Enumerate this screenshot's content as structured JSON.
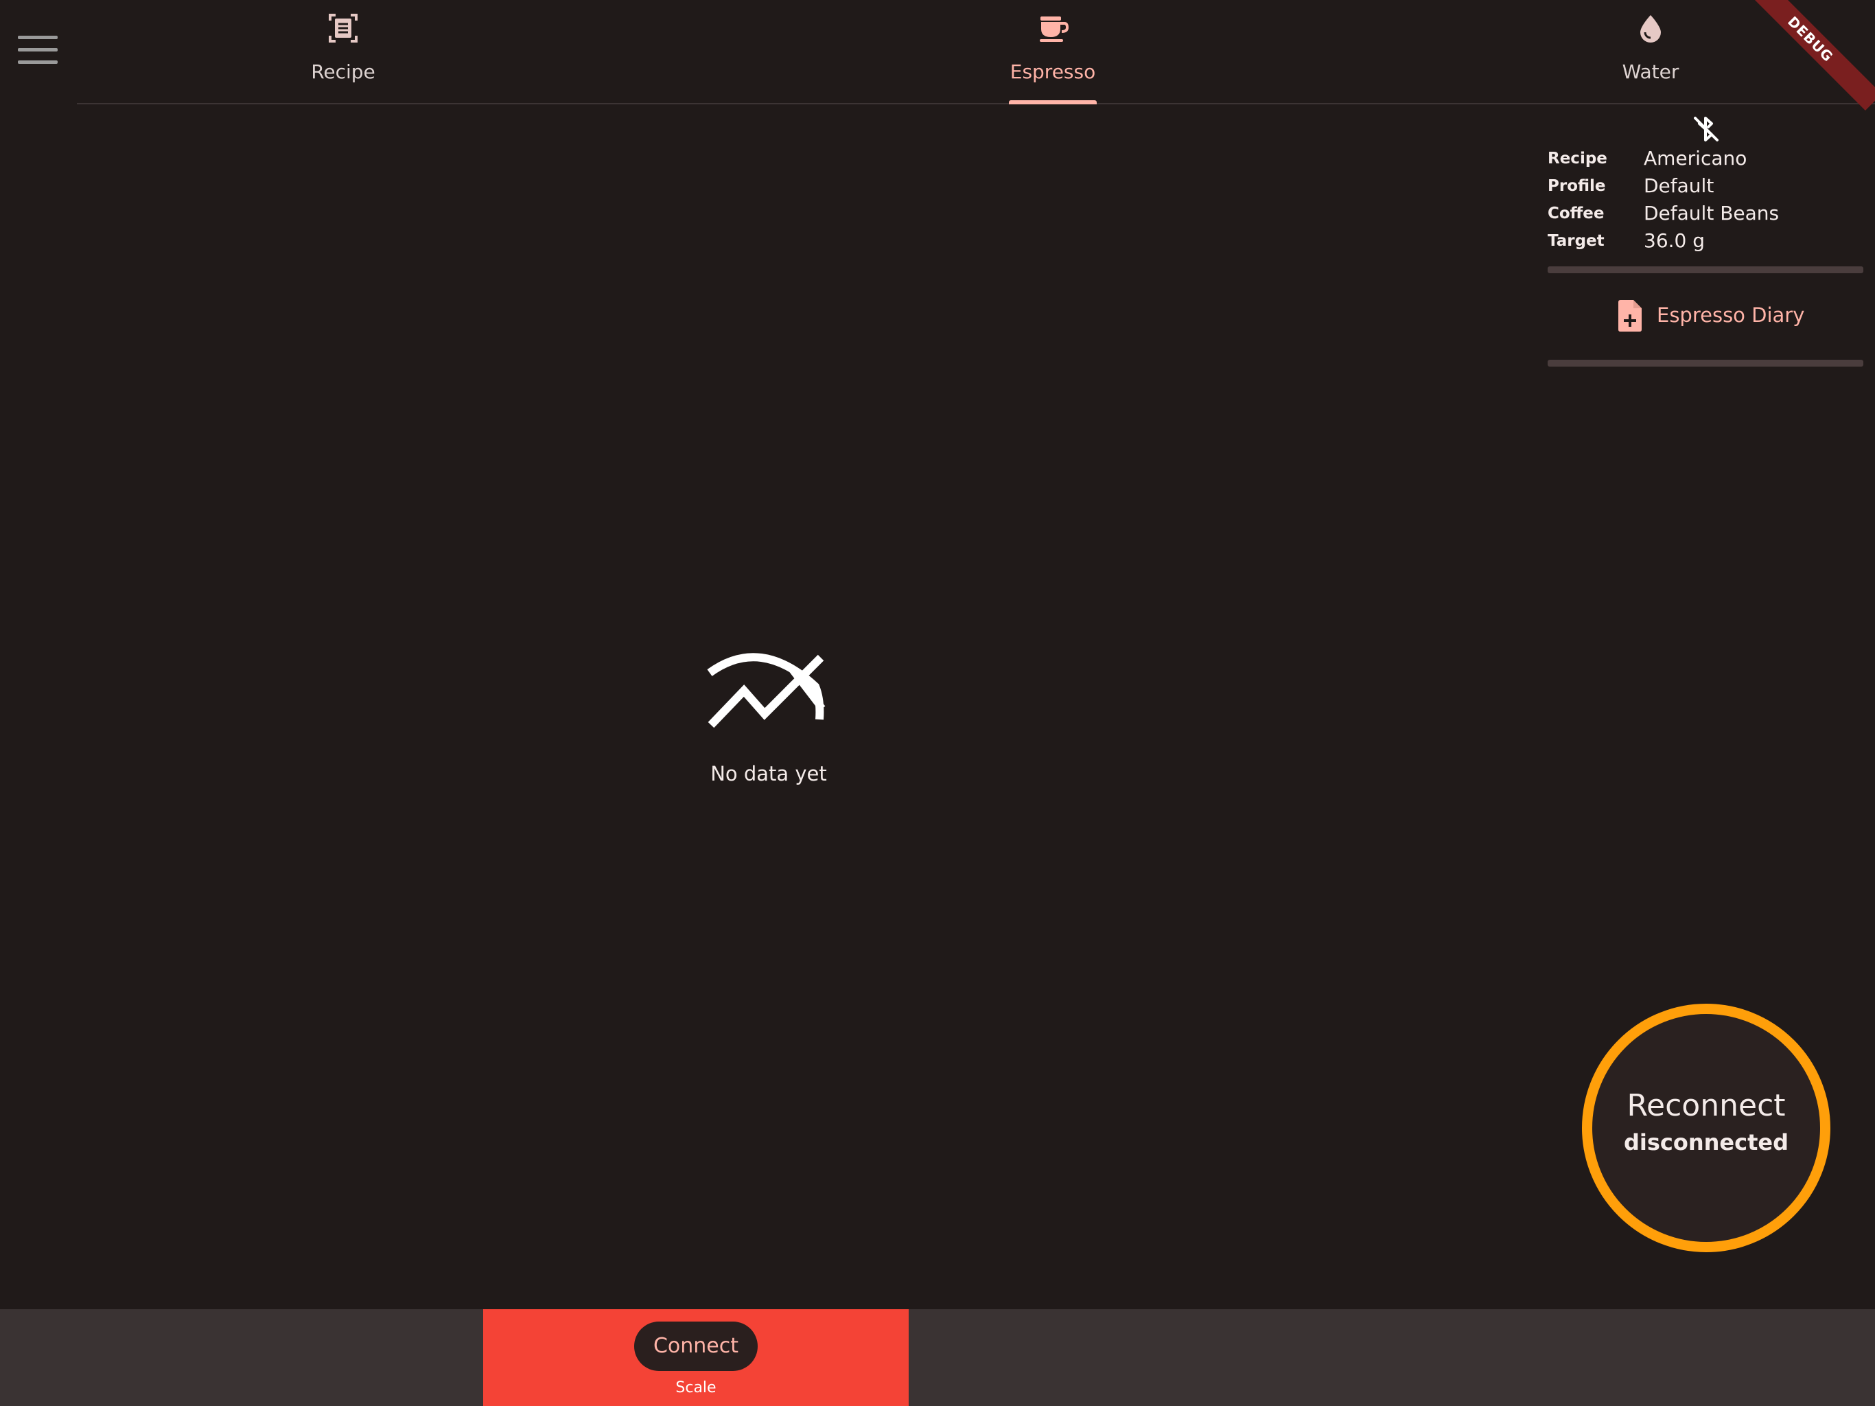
{
  "tabs": [
    {
      "label": "Recipe",
      "icon": "recipe-icon"
    },
    {
      "label": "Espresso",
      "icon": "coffee-cup-icon",
      "active": true
    },
    {
      "label": "Water",
      "icon": "water-drop-icon"
    }
  ],
  "debug_banner": "DEBUG",
  "info_panel": {
    "status_icon": "bluetooth-disabled-icon",
    "rows": [
      {
        "key": "Recipe",
        "value": "Americano"
      },
      {
        "key": "Profile",
        "value": "Default"
      },
      {
        "key": "Coffee",
        "value": "Default Beans"
      },
      {
        "key": "Target",
        "value": "36.0 g"
      }
    ],
    "diary_label": "Espresso Diary"
  },
  "chart": {
    "empty_text": "No data yet",
    "empty_icon": "chart-off-icon"
  },
  "reconnect": {
    "title": "Reconnect",
    "status": "disconnected",
    "ring_color": "#ff9f0a"
  },
  "bottom": {
    "connect_label": "Connect",
    "scale_label": "Scale",
    "panel_color": "#f44336"
  },
  "colors": {
    "background": "#201a19",
    "accent": "#ffb4a8",
    "bottom_bar": "#3a3333"
  }
}
